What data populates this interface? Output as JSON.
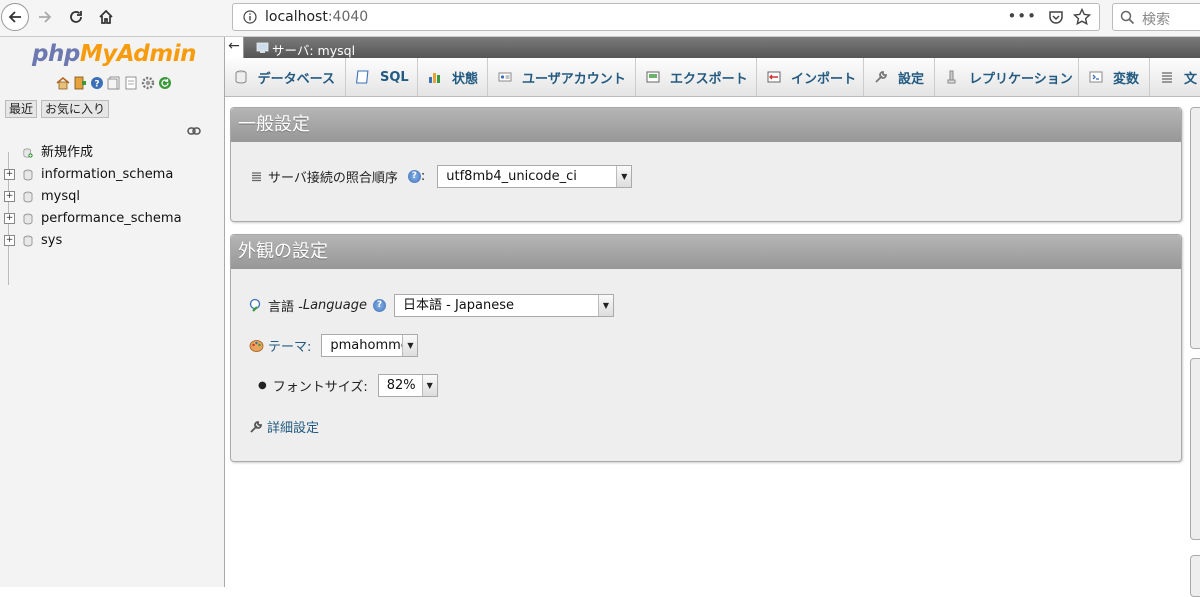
{
  "browser": {
    "url_host": "localhost",
    "url_port": ":4040",
    "more_label": "•••",
    "search_placeholder": "検索"
  },
  "nav": {
    "logo_php": "php",
    "logo_myadmin": "MyAdmin",
    "tabs": [
      {
        "label": "最近"
      },
      {
        "label": "お気に入り"
      }
    ],
    "tree": [
      {
        "label": "新規作成"
      },
      {
        "label": "information_schema"
      },
      {
        "label": "mysql"
      },
      {
        "label": "performance_schema"
      },
      {
        "label": "sys"
      }
    ]
  },
  "server_bar": {
    "collapse": "←",
    "label": "サーバ: mysql"
  },
  "topmenu": [
    {
      "label": "データベース"
    },
    {
      "label": "SQL"
    },
    {
      "label": "状態"
    },
    {
      "label": "ユーザアカウント"
    },
    {
      "label": "エクスポート"
    },
    {
      "label": "インポート"
    },
    {
      "label": "設定"
    },
    {
      "label": "レプリケーション"
    },
    {
      "label": "変数"
    },
    {
      "label": "文"
    }
  ],
  "general": {
    "title": "一般設定",
    "collation_label": "サーバ接続の照合順序",
    "collation_colon": ":",
    "collation_value": "utf8mb4_unicode_ci"
  },
  "appearance": {
    "title": "外観の設定",
    "language_label": "言語 - ",
    "language_label_en": "Language",
    "language_value": "日本語 - Japanese",
    "theme_label": "テーマ:",
    "theme_value": "pmahomme",
    "fontsize_label": "フォントサイズ:",
    "fontsize_value": "82%",
    "advanced_label": "詳細設定"
  }
}
